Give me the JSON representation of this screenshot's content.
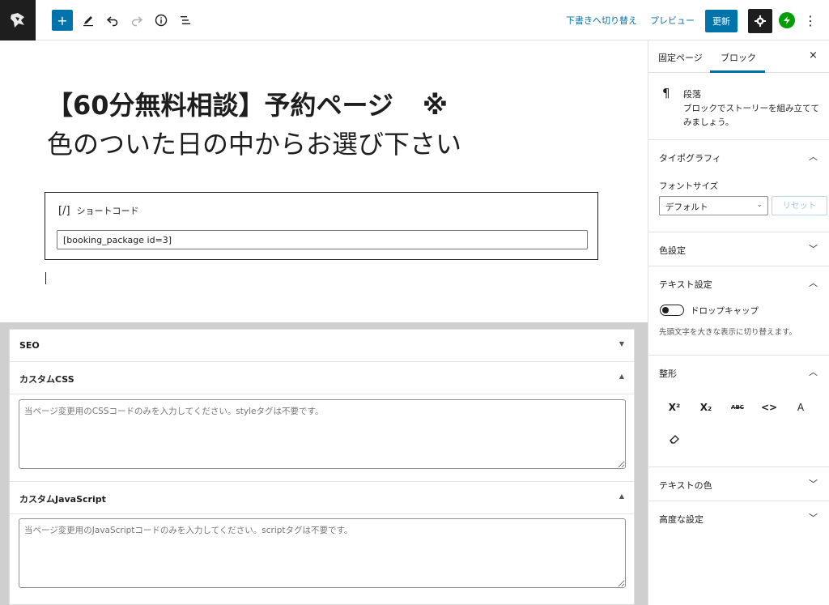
{
  "topbar": {
    "add_icon": "plus",
    "tools": [
      "pencil-icon",
      "undo-icon",
      "redo-icon",
      "info-icon",
      "list-view-icon"
    ],
    "switch_to_draft": "下書きへ切り替え",
    "preview": "プレビュー",
    "update": "更新",
    "settings_icon": "gear",
    "jetpack_icon": "bolt",
    "more_icon": "⋮"
  },
  "editor": {
    "heading_line1": "【60分無料相談】予約ページ",
    "heading_mark": "※",
    "heading_line2": "色のついた日の中からお選び下さい",
    "shortcode": {
      "icon": "[/]",
      "label": "ショートコード",
      "value": "[booking_package id=3]"
    }
  },
  "meta": {
    "seo": {
      "title": "SEO",
      "arrow": "▼"
    },
    "css": {
      "title": "カスタムCSS",
      "arrow": "▲",
      "placeholder": "当ページ変更用のCSSコードのみを入力してください。styleタグは不要です。"
    },
    "js": {
      "title": "カスタムJavaScript",
      "arrow": "▲",
      "placeholder": "当ページ変更用のJavaScriptコードのみを入力してください。scriptタグは不要です。"
    }
  },
  "sidebar": {
    "tab_page": "固定ページ",
    "tab_block": "ブロック",
    "close": "×",
    "block": {
      "icon": "¶",
      "name": "段落",
      "description": "ブロックでストーリーを組み立ててみましょう。"
    },
    "typography": {
      "title": "タイポグラフィ",
      "font_size_label": "フォントサイズ",
      "font_size_value": "デフォルト",
      "reset": "リセット"
    },
    "color_settings": "色設定",
    "text_settings": {
      "title": "テキスト設定",
      "drop_cap": "ドロップキャップ",
      "drop_cap_help": "先頭文字を大きな表示に切り替えます。",
      "drop_cap_enabled": false
    },
    "formatting": {
      "title": "整形",
      "buttons": [
        "X²",
        "X₂",
        "ABC",
        "<>",
        "A"
      ]
    },
    "text_color": "テキストの色",
    "advanced": "高度な設定"
  }
}
